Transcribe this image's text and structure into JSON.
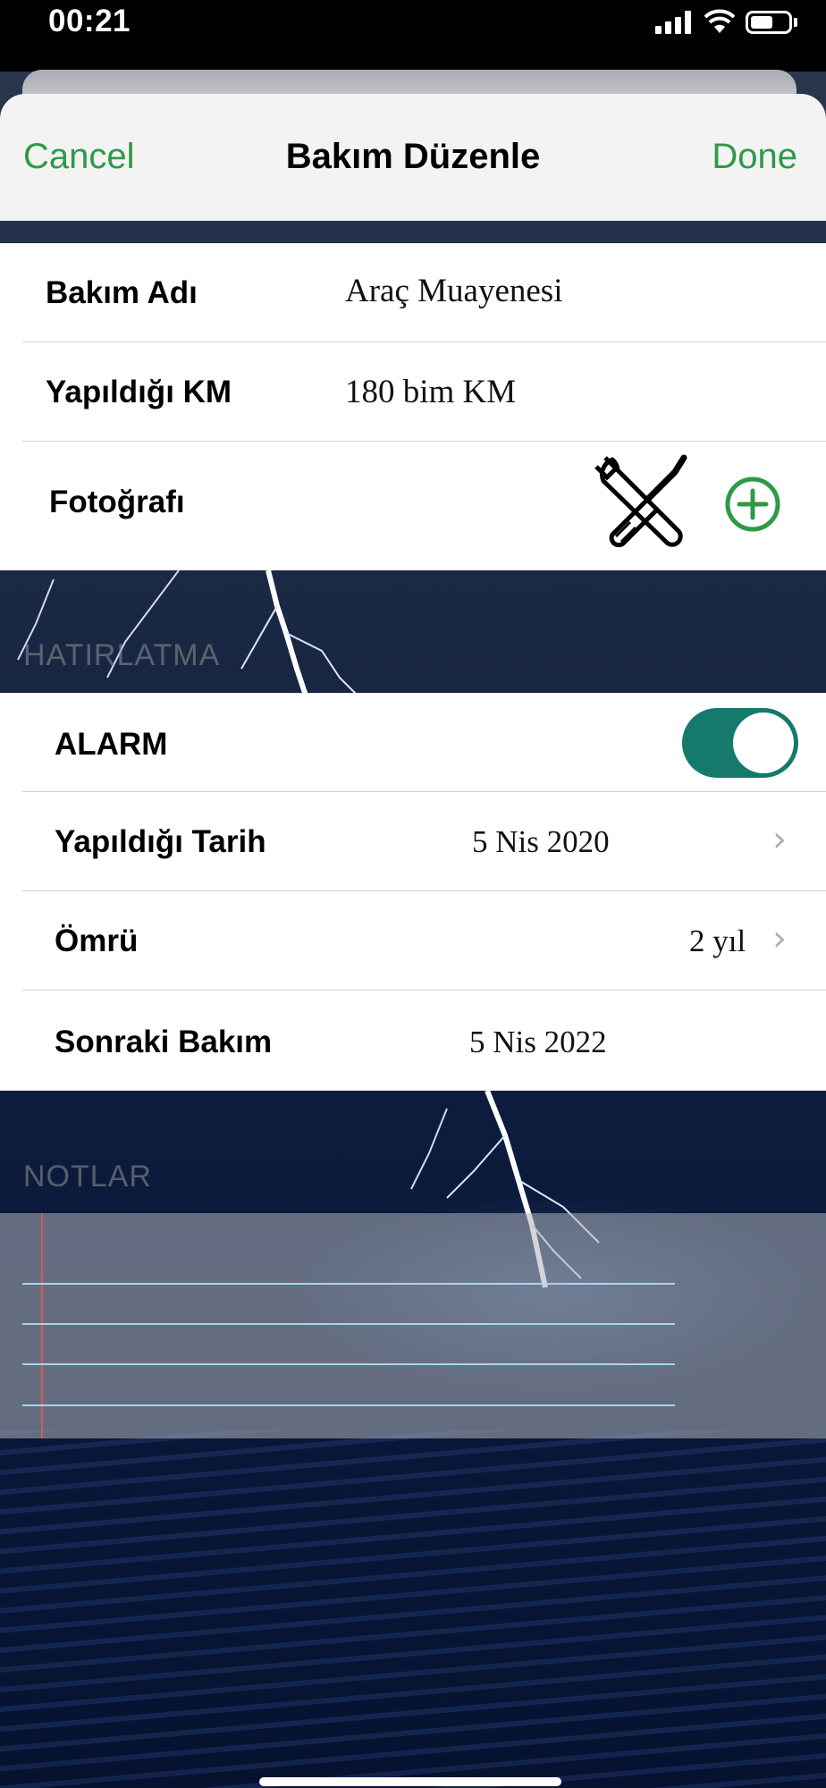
{
  "status_bar": {
    "time": "00:21"
  },
  "nav": {
    "cancel": "Cancel",
    "title": "Bakım Düzenle",
    "done": "Done"
  },
  "form": {
    "bakim_adi": {
      "label": "Bakım Adı",
      "value": "Araç Muayenesi"
    },
    "yapildigi_km": {
      "label": "Yapıldığı KM",
      "value": "180 bim KM"
    },
    "fotografi": {
      "label": "Fotoğrafı",
      "image_icon": "wrench-screwdriver-icon",
      "add_icon": "plus-circle-icon"
    }
  },
  "reminder": {
    "header": "HATIRLATMA",
    "alarm": {
      "label": "ALARM",
      "on": true
    },
    "yapildigi_tarih": {
      "label": "Yapıldığı Tarih",
      "value": "5 Nis 2020"
    },
    "omru": {
      "label": "Ömrü",
      "value": "2 yıl"
    },
    "sonraki_bakim": {
      "label": "Sonraki Bakım",
      "value": "5 Nis 2022"
    }
  },
  "notes": {
    "header": "NOTLAR",
    "text": ""
  },
  "colors": {
    "accent": "#2e9a48",
    "toggle_on": "#157a6c"
  }
}
